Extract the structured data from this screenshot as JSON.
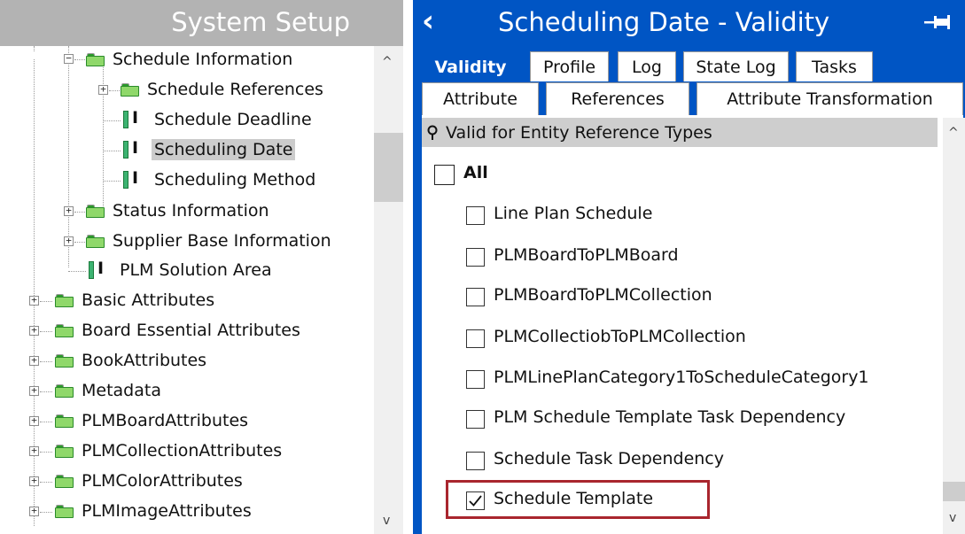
{
  "left_panel": {
    "title": "System Setup",
    "scroll_up": "^",
    "scroll_down": "v",
    "tree": [
      {
        "label": "Schedule Information",
        "icon": "folder-icon",
        "expander": "−",
        "selected": false
      },
      {
        "label": "Schedule References",
        "icon": "folder-icon",
        "expander": "+",
        "selected": false
      },
      {
        "label": "Schedule Deadline",
        "icon": "attribute-icon",
        "expander": "",
        "selected": false
      },
      {
        "label": "Scheduling Date",
        "icon": "attribute-icon",
        "expander": "",
        "selected": true
      },
      {
        "label": "Scheduling Method",
        "icon": "attribute-icon",
        "expander": "",
        "selected": false
      },
      {
        "label": "Status Information",
        "icon": "folder-icon",
        "expander": "+",
        "selected": false
      },
      {
        "label": "Supplier Base Information",
        "icon": "folder-icon",
        "expander": "+",
        "selected": false
      },
      {
        "label": "PLM Solution Area",
        "icon": "attribute-icon",
        "expander": "",
        "selected": false
      },
      {
        "label": "Basic Attributes",
        "icon": "folder-icon",
        "expander": "+",
        "selected": false
      },
      {
        "label": "Board Essential Attributes",
        "icon": "folder-icon",
        "expander": "+",
        "selected": false
      },
      {
        "label": "BookAttributes",
        "icon": "folder-icon",
        "expander": "+",
        "selected": false
      },
      {
        "label": "Metadata",
        "icon": "folder-icon",
        "expander": "+",
        "selected": false
      },
      {
        "label": "PLMBoardAttributes",
        "icon": "folder-icon",
        "expander": "+",
        "selected": false
      },
      {
        "label": "PLMCollectionAttributes",
        "icon": "folder-icon",
        "expander": "+",
        "selected": false
      },
      {
        "label": "PLMColorAttributes",
        "icon": "folder-icon",
        "expander": "+",
        "selected": false
      },
      {
        "label": "PLMImageAttributes",
        "icon": "folder-icon",
        "expander": "+",
        "selected": false
      }
    ]
  },
  "right_panel": {
    "title": "Scheduling Date - Validity",
    "back_icon": "chevron-left-icon",
    "pin_icon": "pin-icon",
    "tabs_row1": [
      {
        "label": "Validity",
        "active": true
      },
      {
        "label": "Profile",
        "active": false
      },
      {
        "label": "Log",
        "active": false
      },
      {
        "label": "State Log",
        "active": false
      },
      {
        "label": "Tasks",
        "active": false
      }
    ],
    "tabs_row2": [
      {
        "label": "Attribute",
        "active": false
      },
      {
        "label": "References",
        "active": false
      },
      {
        "label": "Attribute Transformation",
        "active": false
      }
    ],
    "section": {
      "title": "Valid for Entity Reference Types",
      "icon": "pin-icon"
    },
    "all_option": {
      "label": "All",
      "checked": false
    },
    "options": [
      {
        "label": "Line Plan Schedule",
        "checked": false
      },
      {
        "label": "PLMBoardToPLMBoard",
        "checked": false
      },
      {
        "label": "PLMBoardToPLMCollection",
        "checked": false
      },
      {
        "label": "PLMCollectiobToPLMCollection",
        "checked": false
      },
      {
        "label": "PLMLinePlanCategory1ToScheduleCategory1",
        "checked": false
      },
      {
        "label": "PLM Schedule Template Task Dependency",
        "checked": false
      },
      {
        "label": "Schedule Task Dependency",
        "checked": false
      },
      {
        "label": "Schedule Template",
        "checked": true
      }
    ],
    "scroll_up": "^",
    "scroll_down": "v",
    "highlight_color": "#a9262e"
  },
  "colors": {
    "accent_blue": "#0055c4",
    "left_header_gray": "#b3b3b3",
    "selection_gray": "#cccccc",
    "folder_green": "#8fd86a"
  }
}
